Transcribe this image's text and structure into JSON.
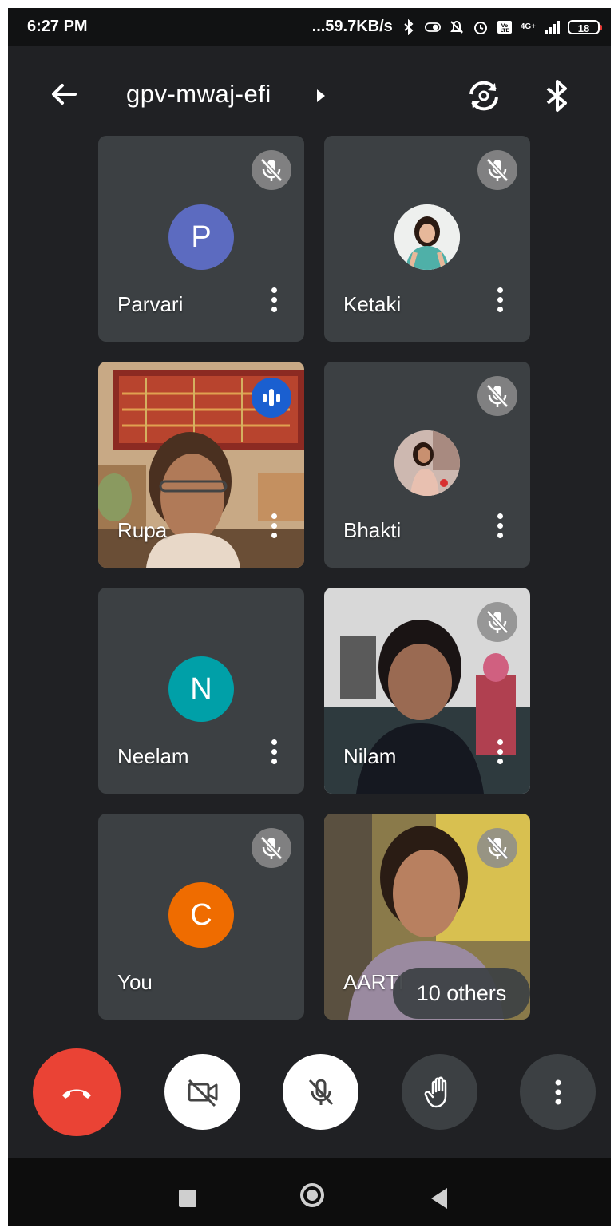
{
  "status_bar": {
    "time": "6:27 PM",
    "speed": "...59.7KB/s",
    "network": "4G+",
    "battery": "18",
    "icons": [
      "bluetooth-icon",
      "data-saver-icon",
      "mute-icon",
      "alarm-icon",
      "volte-icon",
      "signal-icon",
      "battery-icon"
    ]
  },
  "header": {
    "meeting_code": "gpv-mwaj-efi",
    "icons": [
      "back-arrow-icon",
      "caret-right-icon",
      "switch-camera-icon",
      "bluetooth-audio-icon"
    ]
  },
  "participants": [
    {
      "name": "Parvari",
      "initial": "P",
      "avatar_color": "#5c6bc0",
      "muted": true
    },
    {
      "name": "Ketaki",
      "avatar": "photo",
      "muted": true
    },
    {
      "name": "Rupa",
      "video": true,
      "speaking": true
    },
    {
      "name": "Bhakti",
      "avatar": "photo",
      "muted": true
    },
    {
      "name": "Neelam",
      "initial": "N",
      "avatar_color": "#00a0a8",
      "muted": false
    },
    {
      "name": "Nilam",
      "video": true,
      "muted": true
    },
    {
      "name": "You",
      "initial": "C",
      "avatar_color": "#ef6c00",
      "muted": true
    },
    {
      "name": "AARTI",
      "video": true,
      "muted": true
    }
  ],
  "others_label": "10 others",
  "controls": {
    "end_call": "end-call",
    "camera": "camera-off",
    "mic": "mic-off",
    "raise_hand": "raise-hand",
    "more": "more-options"
  },
  "colors": {
    "background": "#202124",
    "tile": "#3c4043",
    "end_call": "#ea4335",
    "speaking": "#1a5fd0"
  }
}
